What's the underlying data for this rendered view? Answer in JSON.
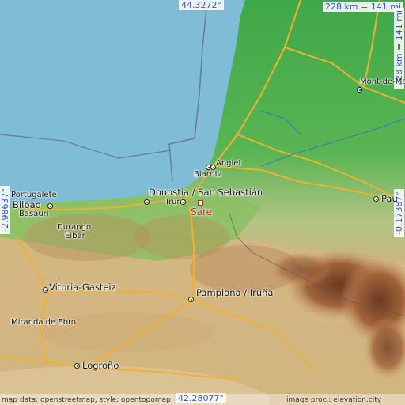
{
  "coords": {
    "top": "44.3272°",
    "bottom": "42.28077°",
    "left": "-2.98637°",
    "right": "-0.17387°"
  },
  "scale": {
    "top": "228 km = 141 mi",
    "right": "228 km = 141 mi"
  },
  "highlight": {
    "name": "Sare",
    "color": "#e02020"
  },
  "places": {
    "mont_de_marsan": "Mont-de-Ma",
    "anglet": "Anglet",
    "biarritz": "Biarritz",
    "donostia": "Donostia / San Sebastián",
    "irun": "Irun",
    "portugalete": "Portugalete",
    "bilbao": "Bilbao",
    "basauri": "Basauri",
    "durango": "Durango",
    "eibar": "Eibar",
    "vitoria": "Vitoria-Gasteiz",
    "pamplona": "Pamplona / Iruña",
    "miranda": "Miranda de Ebro",
    "logrono": "Logroño",
    "pau": "Pau"
  },
  "credits": {
    "left": "map data: openstreetmap, style: opentopomap",
    "right": "image proc.: elevation.city"
  },
  "colors": {
    "sea": "#7fbcd6",
    "lowland": "#4cae4c",
    "hills": "#c9a86a",
    "mountains": "#8a4a2a",
    "roads": "#f0b030",
    "coord_text": "#3850d8"
  }
}
